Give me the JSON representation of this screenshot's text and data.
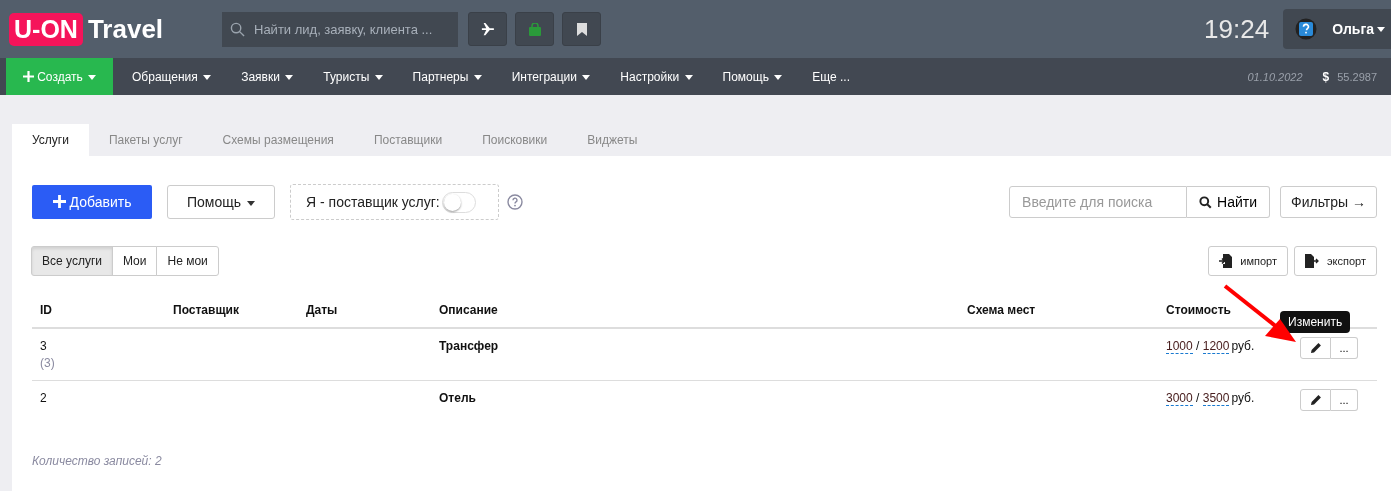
{
  "header": {
    "logo_badge": "U-ON",
    "logo_text": "Travel",
    "search": {
      "placeholder": "Найти лид, заявку, клиента ..."
    },
    "clock": "19:24",
    "user": "Ольга"
  },
  "nav": {
    "create": "Создать",
    "items": [
      "Обращения",
      "Заявки",
      "Туристы",
      "Партнеры",
      "Интеграции",
      "Настройки",
      "Помощь"
    ],
    "more": "Еще ...",
    "date": "01.10.2022",
    "currency_sign": "$",
    "rate": "55.2987"
  },
  "tabs": [
    {
      "label": "Услуги",
      "selected": true
    },
    {
      "label": "Пакеты услуг",
      "selected": false
    },
    {
      "label": "Схемы размещения",
      "selected": false
    },
    {
      "label": "Поставщики",
      "selected": false
    },
    {
      "label": "Поисковики",
      "selected": false
    },
    {
      "label": "Виджеты",
      "selected": false
    }
  ],
  "toolbar": {
    "add": "Добавить",
    "help": "Помощь",
    "supplier_toggle": {
      "label": "Я - поставщик услуг:",
      "on": false
    },
    "search": {
      "placeholder": "Введите для поиска"
    },
    "find": "Найти",
    "filters": "Фильтры →"
  },
  "filters": [
    {
      "label": "Все услуги",
      "selected": true
    },
    {
      "label": "Мои",
      "selected": false
    },
    {
      "label": "Не мои",
      "selected": false
    }
  ],
  "import": "импорт",
  "export": "экспорт",
  "table": {
    "columns": [
      "ID",
      "Поставщик",
      "Даты",
      "Описание",
      "Схема мест",
      "Стоимость"
    ],
    "rows": [
      {
        "id": "3",
        "sub": "(3)",
        "description": "Трансфер",
        "prices": [
          "1000",
          "1200"
        ],
        "separator": "/",
        "unit": "руб.",
        "more": "...",
        "tooltip": "Изменить"
      },
      {
        "id": "2",
        "description": "Отель",
        "prices": [
          "3000",
          "3500"
        ],
        "separator": "/",
        "unit": "руб.",
        "more": "..."
      }
    ]
  },
  "footer": "Количество записей: 2"
}
